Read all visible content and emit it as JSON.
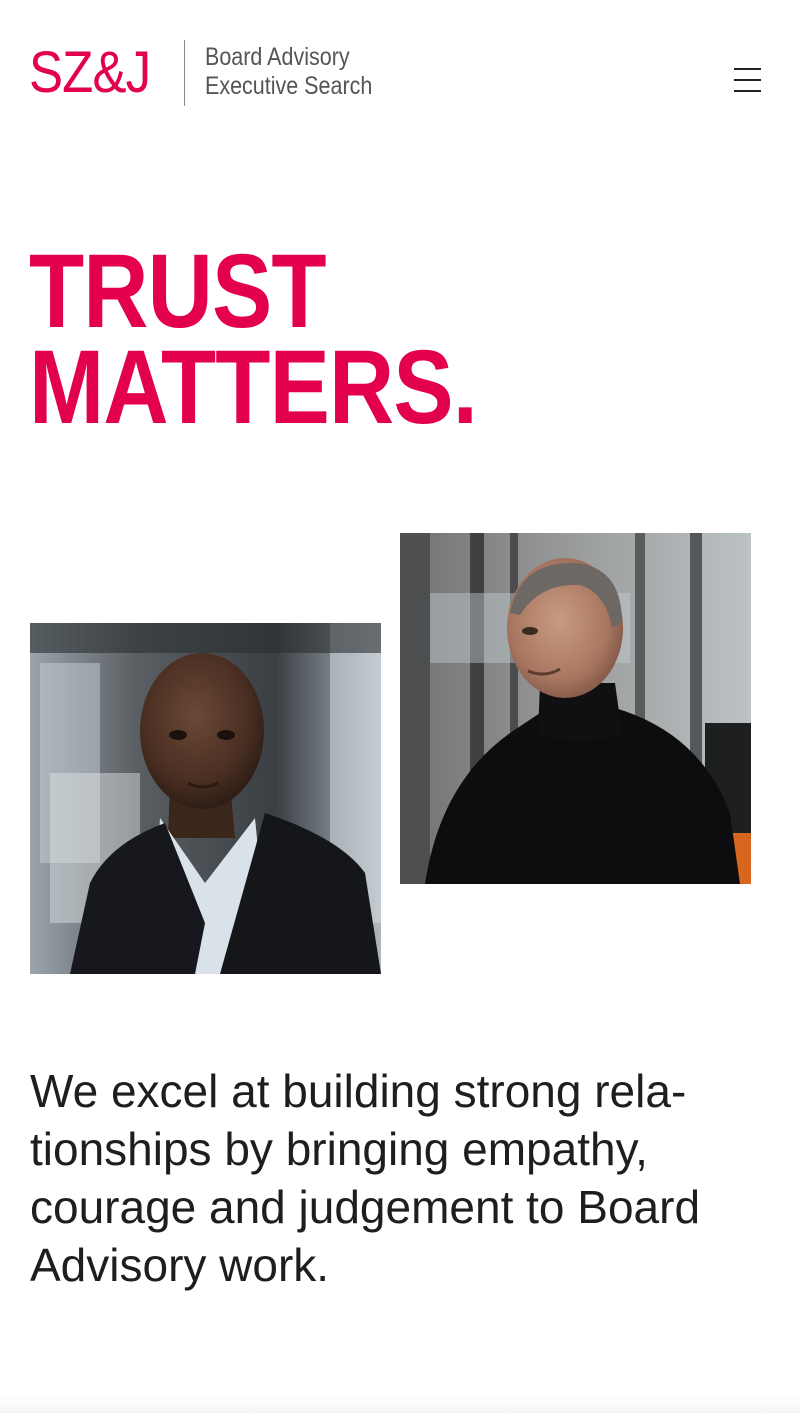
{
  "brand": {
    "logo_text": "SZ&J",
    "tagline_line1": "Board Advisory",
    "tagline_line2": "Executive Search",
    "accent_color": "#e2004f"
  },
  "nav": {
    "menu_icon": "hamburger-menu-icon"
  },
  "hero": {
    "headline_line1": "TRUST",
    "headline_line2": "MATTERS."
  },
  "photos": {
    "left": "portrait-man-dark-blazer",
    "right": "portrait-man-black-turtleneck"
  },
  "intro": {
    "line1": "We excel at building strong rela-",
    "line2": "tionships by bringing empathy,",
    "line3": "courage and judgement to Board",
    "line4": "Advisory work."
  }
}
